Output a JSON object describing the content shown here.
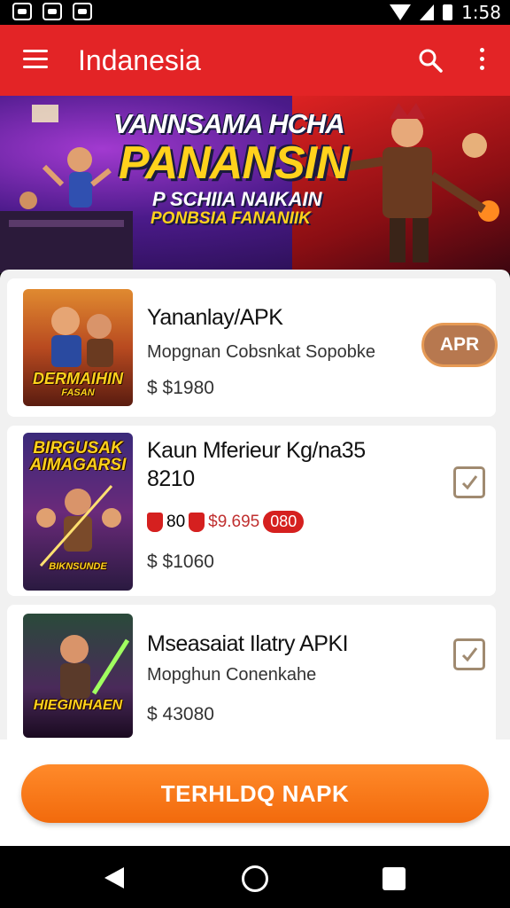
{
  "status_bar": {
    "time": "1:58"
  },
  "app_bar": {
    "title": "Indanesia"
  },
  "banner": {
    "headline_line1": "VANNSAMA HCHA",
    "headline_line2": "PANANSIN",
    "subline1": "P SCHIIA NAIKAIN",
    "subline2": "PONBSIA FANANIIK"
  },
  "items": [
    {
      "thumb_caption": "DERMAIHIN",
      "thumb_caption_small": "FASAN",
      "title": "Yananlay/APK",
      "subtitle": "Mopgnan Cobsnkat Sopobke",
      "price": "$1980",
      "action_label": "APR"
    },
    {
      "thumb_caption": "BIRGUSAK AIMAGARSI",
      "thumb_caption_small": "BIKNSUNDE",
      "title_line1": "Kaun Mferieur Kg/na35",
      "title_line2": "8210",
      "discount_a": "80",
      "discount_b": "$9.695",
      "discount_badge": "080",
      "price": "$1060"
    },
    {
      "thumb_caption": "HIEGINHAEN",
      "title": "Mseasaiat Ilatry APKI",
      "subtitle": "Mopghun Conenkahe",
      "price": "43080"
    }
  ],
  "currency_icon": "dollar-sign-icon",
  "cta": {
    "label": "TERHLDQ NAPK"
  },
  "colors": {
    "app_bar": "#e32426",
    "cta": "#f26a0c",
    "apk_button": "#b7784f"
  }
}
